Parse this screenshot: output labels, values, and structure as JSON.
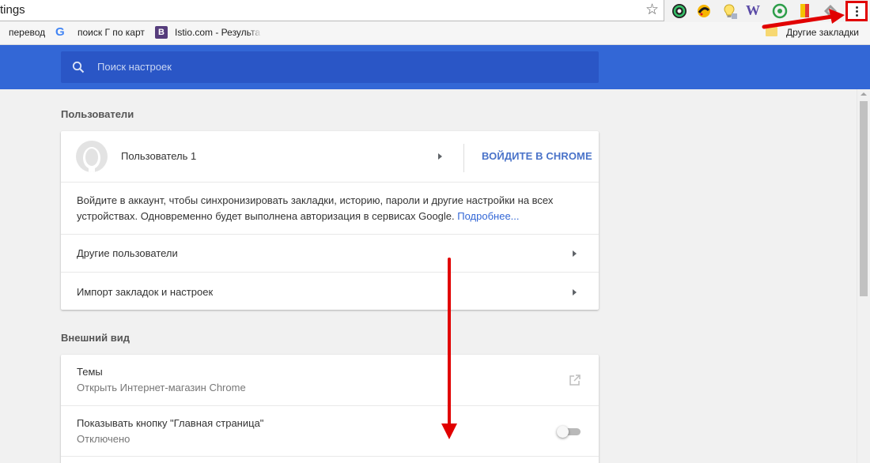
{
  "omnibox": {
    "url_text": "tings",
    "star_icon": "star-icon",
    "extensions": [
      "color-picker-icon",
      "smiley-extension-icon",
      "lightbulb-extension-icon",
      "w-extension-icon",
      "green-circle-extension-icon",
      "bookmark-flag-extension-icon",
      "grey-extension-icon"
    ],
    "w_extension_label": "W",
    "menu_icon": "vertical-dots-icon",
    "highlight_color": "#e10000"
  },
  "bookmarks": {
    "items": [
      {
        "label": "перевод"
      },
      {
        "label": "поиск Г по карт",
        "icon": "google-icon",
        "icon_text": "G"
      },
      {
        "label": "Istio.com - Результа",
        "icon": "bootstrap-icon",
        "icon_text": "B"
      }
    ],
    "other": {
      "label": "Другие закладки",
      "icon": "folder-icon"
    }
  },
  "header": {
    "search_placeholder": "Поиск настроек",
    "color": "#3367d6"
  },
  "sections": {
    "users": {
      "title": "Пользователи",
      "user_name": "Пользователь 1",
      "sign_in_label": "ВОЙДИТЕ В CHROME",
      "sync_text": "Войдите в аккаунт, чтобы синхронизировать закладки, историю, пароли и другие настройки на всех устройствах. Одновременно будет выполнена авторизация в сервисах Google.",
      "sync_link": "Подробнее...",
      "other_users": "Другие пользователи",
      "import": "Импорт закладок и настроек"
    },
    "appearance": {
      "title": "Внешний вид",
      "themes_label": "Темы",
      "themes_sub": "Открыть Интернет-магазин Chrome",
      "home_label": "Показывать кнопку \"Главная страница\"",
      "home_sub": "Отключено",
      "home_enabled": false
    }
  },
  "annotation_color": "#e10000"
}
